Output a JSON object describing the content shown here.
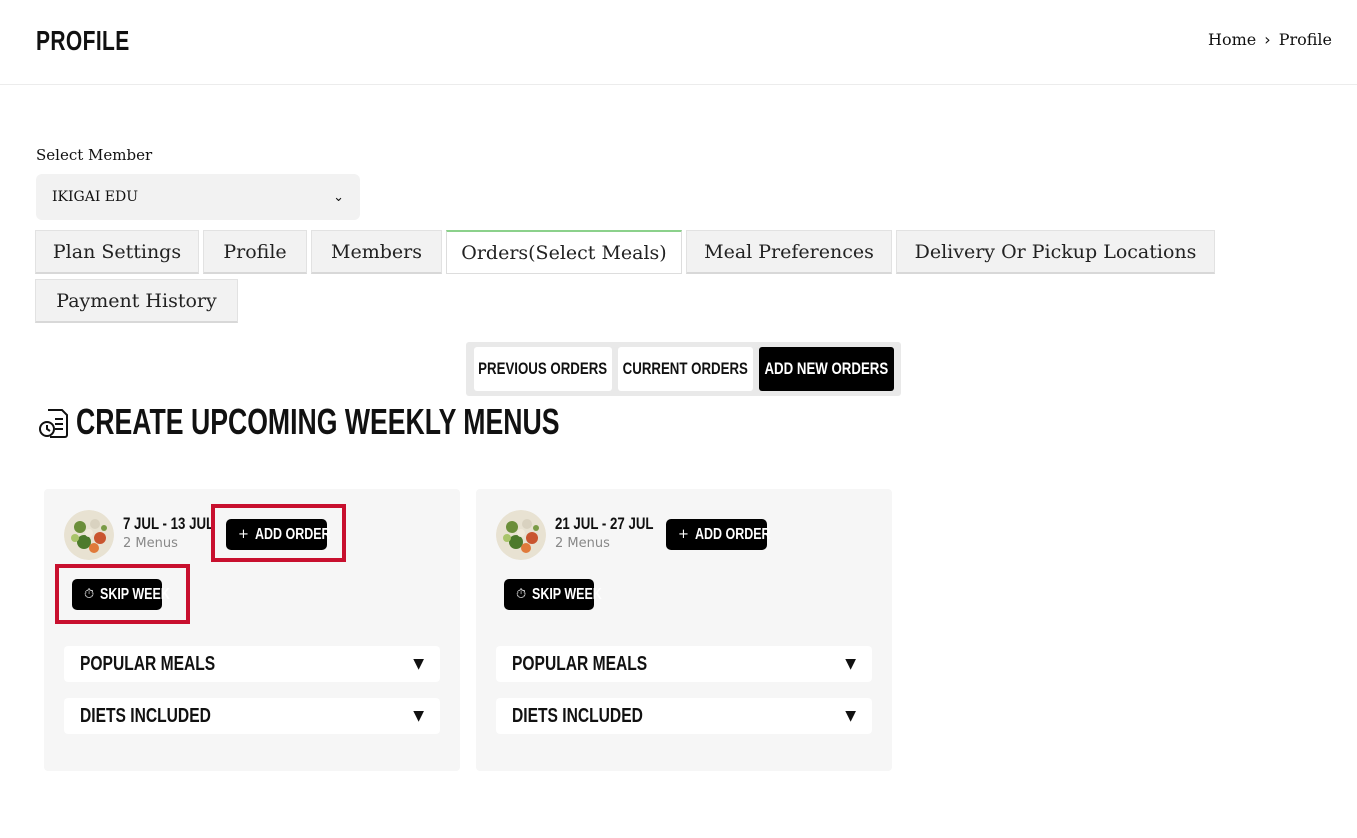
{
  "header": {
    "title": "PROFILE",
    "breadcrumb": {
      "home": "Home",
      "separator": "›",
      "current": "Profile"
    }
  },
  "member_select": {
    "label": "Select Member",
    "value": "IKIGAI EDU"
  },
  "tabs": [
    {
      "label": "Plan Settings"
    },
    {
      "label": "Profile"
    },
    {
      "label": "Members"
    },
    {
      "label": "Orders(Select Meals)",
      "active": true
    },
    {
      "label": "Meal Preferences"
    },
    {
      "label": "Delivery Or Pickup Locations"
    },
    {
      "label": "Payment History"
    }
  ],
  "order_segments": {
    "previous": "PREVIOUS ORDERS",
    "current": "CURRENT ORDERS",
    "add_new": "ADD NEW ORDERS",
    "selected": "add_new"
  },
  "section": {
    "title": "CREATE UPCOMING WEEKLY MENUS",
    "icon": "menu-clock-icon"
  },
  "weeks": [
    {
      "date_range": "7 JUL - 13 JUL",
      "menus": "2 Menus",
      "add_order_label": "ADD ORDER",
      "skip_week_label": "SKIP WEEK",
      "accordions": [
        "POPULAR MEALS",
        "DIETS INCLUDED"
      ]
    },
    {
      "date_range": "21 JUL - 27 JUL",
      "menus": "2 Menus",
      "add_order_label": "ADD ORDER",
      "skip_week_label": "SKIP WEEK",
      "accordions": [
        "POPULAR MEALS",
        "DIETS INCLUDED"
      ]
    }
  ],
  "colors": {
    "highlight": "#c8102e",
    "active_tab_border": "#8bd18b",
    "button_dark": "#000000",
    "card_bg": "#f6f6f6"
  }
}
